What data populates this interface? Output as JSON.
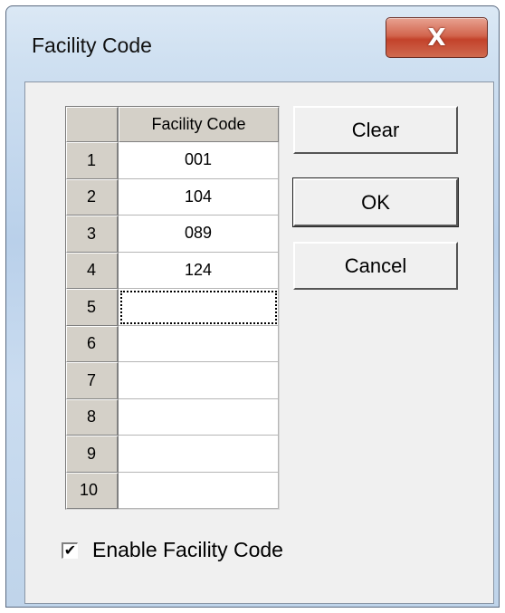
{
  "window": {
    "title": "Facility Code",
    "close_glyph": "X"
  },
  "grid": {
    "column_header": "Facility Code",
    "rows": [
      {
        "num": "1",
        "value": "001"
      },
      {
        "num": "2",
        "value": "104"
      },
      {
        "num": "3",
        "value": "089"
      },
      {
        "num": "4",
        "value": "124"
      },
      {
        "num": "5",
        "value": ""
      },
      {
        "num": "6",
        "value": ""
      },
      {
        "num": "7",
        "value": ""
      },
      {
        "num": "8",
        "value": ""
      },
      {
        "num": "9",
        "value": ""
      },
      {
        "num": "10",
        "value": ""
      }
    ]
  },
  "buttons": {
    "clear": "Clear",
    "ok": "OK",
    "cancel": "Cancel"
  },
  "checkbox": {
    "label": "Enable Facility Code",
    "checked": true,
    "check_glyph": "✔"
  }
}
